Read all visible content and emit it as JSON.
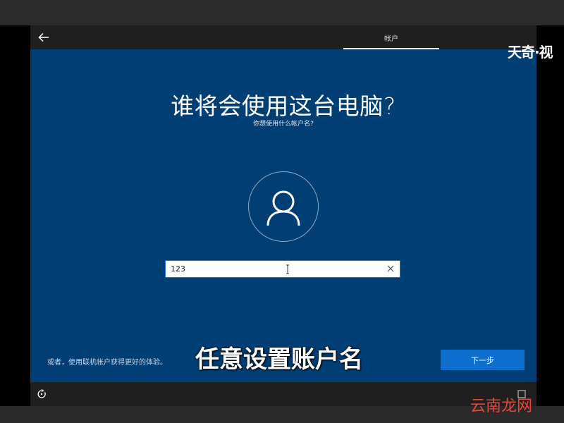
{
  "window": {
    "tab_label": "帐户",
    "title": "谁将会使用这台电脑?",
    "subtitle": "你想使用什么帐户名?",
    "name_field": {
      "value": "123"
    },
    "online_link": "或者，使用联机帐户获得更好的体验。",
    "next_button": "下一步"
  },
  "overlay": {
    "caption": "任意设置账户名",
    "logo_top": "天奇·视",
    "logo_bottom": "云南龙网"
  },
  "colors": {
    "oobe_blue": "#003e74",
    "bar_dark": "#1f1f1f",
    "next_button": "#0f6fcf",
    "watermark_red": "#e7453b"
  },
  "icons": [
    "back-arrow-icon",
    "user-avatar-icon",
    "text-cursor-icon",
    "clear-icon",
    "ease-of-access-icon"
  ]
}
